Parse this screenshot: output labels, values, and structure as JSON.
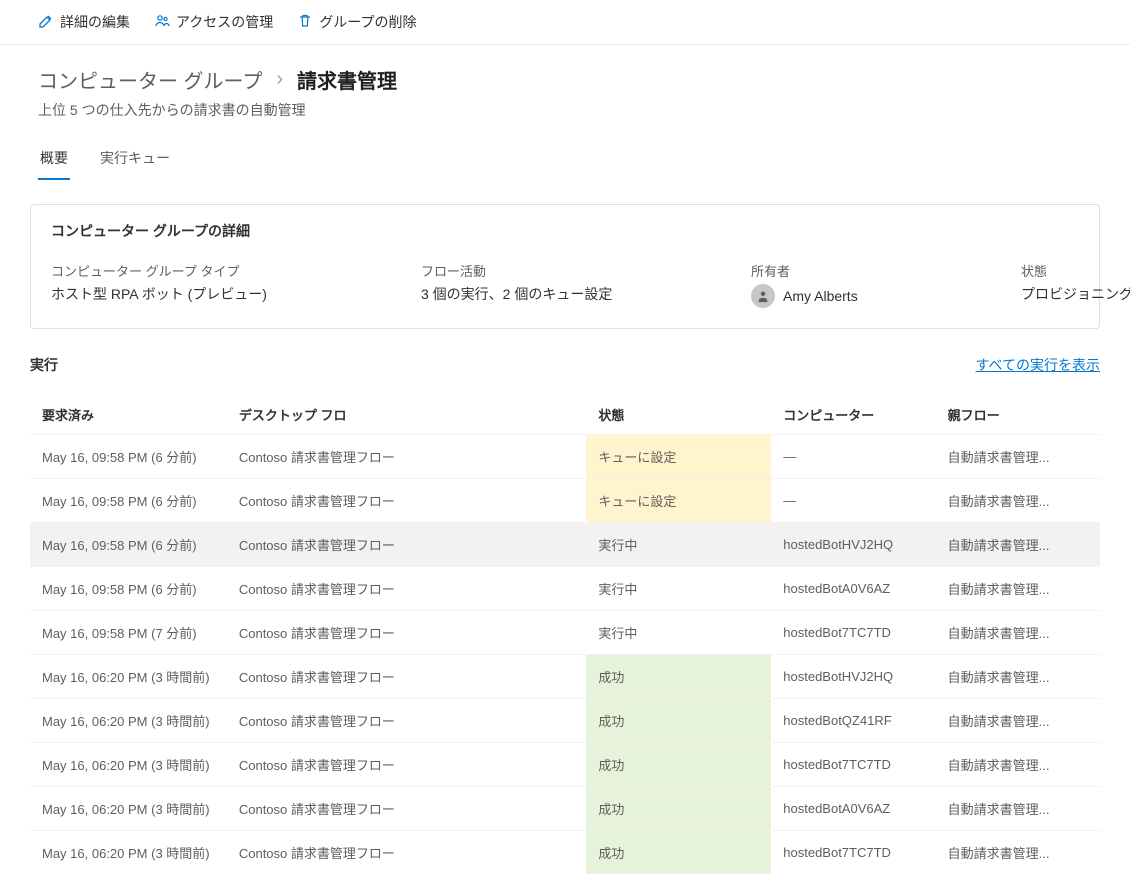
{
  "toolbar": {
    "edit": "詳細の編集",
    "manage_access": "アクセスの管理",
    "delete_group": "グループの削除"
  },
  "breadcrumb": {
    "parent": "コンピューター グループ",
    "current": "請求書管理"
  },
  "subtitle": "上位 5 つの仕入先からの請求書の自動管理",
  "tabs": {
    "overview": "概要",
    "queue": "実行キュー"
  },
  "details": {
    "title": "コンピューター グループの詳細",
    "type_label": "コンピューター グループ タイプ",
    "type_value": "ホスト型 RPA ボット (プレビュー)",
    "activity_label": "フロー活動",
    "activity_value": "3 個の実行、2 個のキュー設定",
    "owner_label": "所有者",
    "owner_value": "Amy Alberts",
    "state_label": "状態",
    "state_value": "プロビジョニング中"
  },
  "runs": {
    "title": "実行",
    "view_all": "すべての実行を表示",
    "columns": {
      "requested": "要求済み",
      "desktop_flow": "デスクトップ フロ",
      "state": "状態",
      "computer": "コンピューター",
      "parent": "親フロー"
    },
    "rows": [
      {
        "requested": "May 16, 09:58 PM (6 分前)",
        "flow": "Contoso 請求書管理フロー",
        "state": "キューに設定",
        "state_kind": "queued",
        "computer": "—",
        "parent": "自動請求書管理..."
      },
      {
        "requested": "May 16, 09:58 PM (6 分前)",
        "flow": "Contoso 請求書管理フロー",
        "state": "キューに設定",
        "state_kind": "queued",
        "computer": "—",
        "parent": "自動請求書管理..."
      },
      {
        "requested": "May 16, 09:58 PM (6 分前)",
        "flow": "Contoso 請求書管理フロー",
        "state": "実行中",
        "state_kind": "running",
        "computer": "hostedBotHVJ2HQ",
        "parent": "自動請求書管理...",
        "highlight": true
      },
      {
        "requested": "May 16, 09:58 PM (6 分前)",
        "flow": "Contoso 請求書管理フロー",
        "state": "実行中",
        "state_kind": "running",
        "computer": "hostedBotA0V6AZ",
        "parent": "自動請求書管理..."
      },
      {
        "requested": "May 16, 09:58 PM (7 分前)",
        "flow": "Contoso 請求書管理フロー",
        "state": "実行中",
        "state_kind": "running",
        "computer": "hostedBot7TC7TD",
        "parent": "自動請求書管理..."
      },
      {
        "requested": "May 16, 06:20 PM (3 時間前)",
        "flow": "Contoso 請求書管理フロー",
        "state": "成功",
        "state_kind": "success",
        "computer": "hostedBotHVJ2HQ",
        "parent": "自動請求書管理..."
      },
      {
        "requested": "May 16, 06:20 PM (3 時間前)",
        "flow": "Contoso 請求書管理フロー",
        "state": "成功",
        "state_kind": "success",
        "computer": "hostedBotQZ41RF",
        "parent": "自動請求書管理..."
      },
      {
        "requested": "May 16, 06:20 PM (3 時間前)",
        "flow": "Contoso 請求書管理フロー",
        "state": "成功",
        "state_kind": "success",
        "computer": "hostedBot7TC7TD",
        "parent": "自動請求書管理..."
      },
      {
        "requested": "May 16, 06:20 PM (3 時間前)",
        "flow": "Contoso 請求書管理フロー",
        "state": "成功",
        "state_kind": "success",
        "computer": "hostedBotA0V6AZ",
        "parent": "自動請求書管理..."
      },
      {
        "requested": "May 16, 06:20 PM (3 時間前)",
        "flow": "Contoso 請求書管理フロー",
        "state": "成功",
        "state_kind": "success",
        "computer": "hostedBot7TC7TD",
        "parent": "自動請求書管理..."
      }
    ]
  }
}
